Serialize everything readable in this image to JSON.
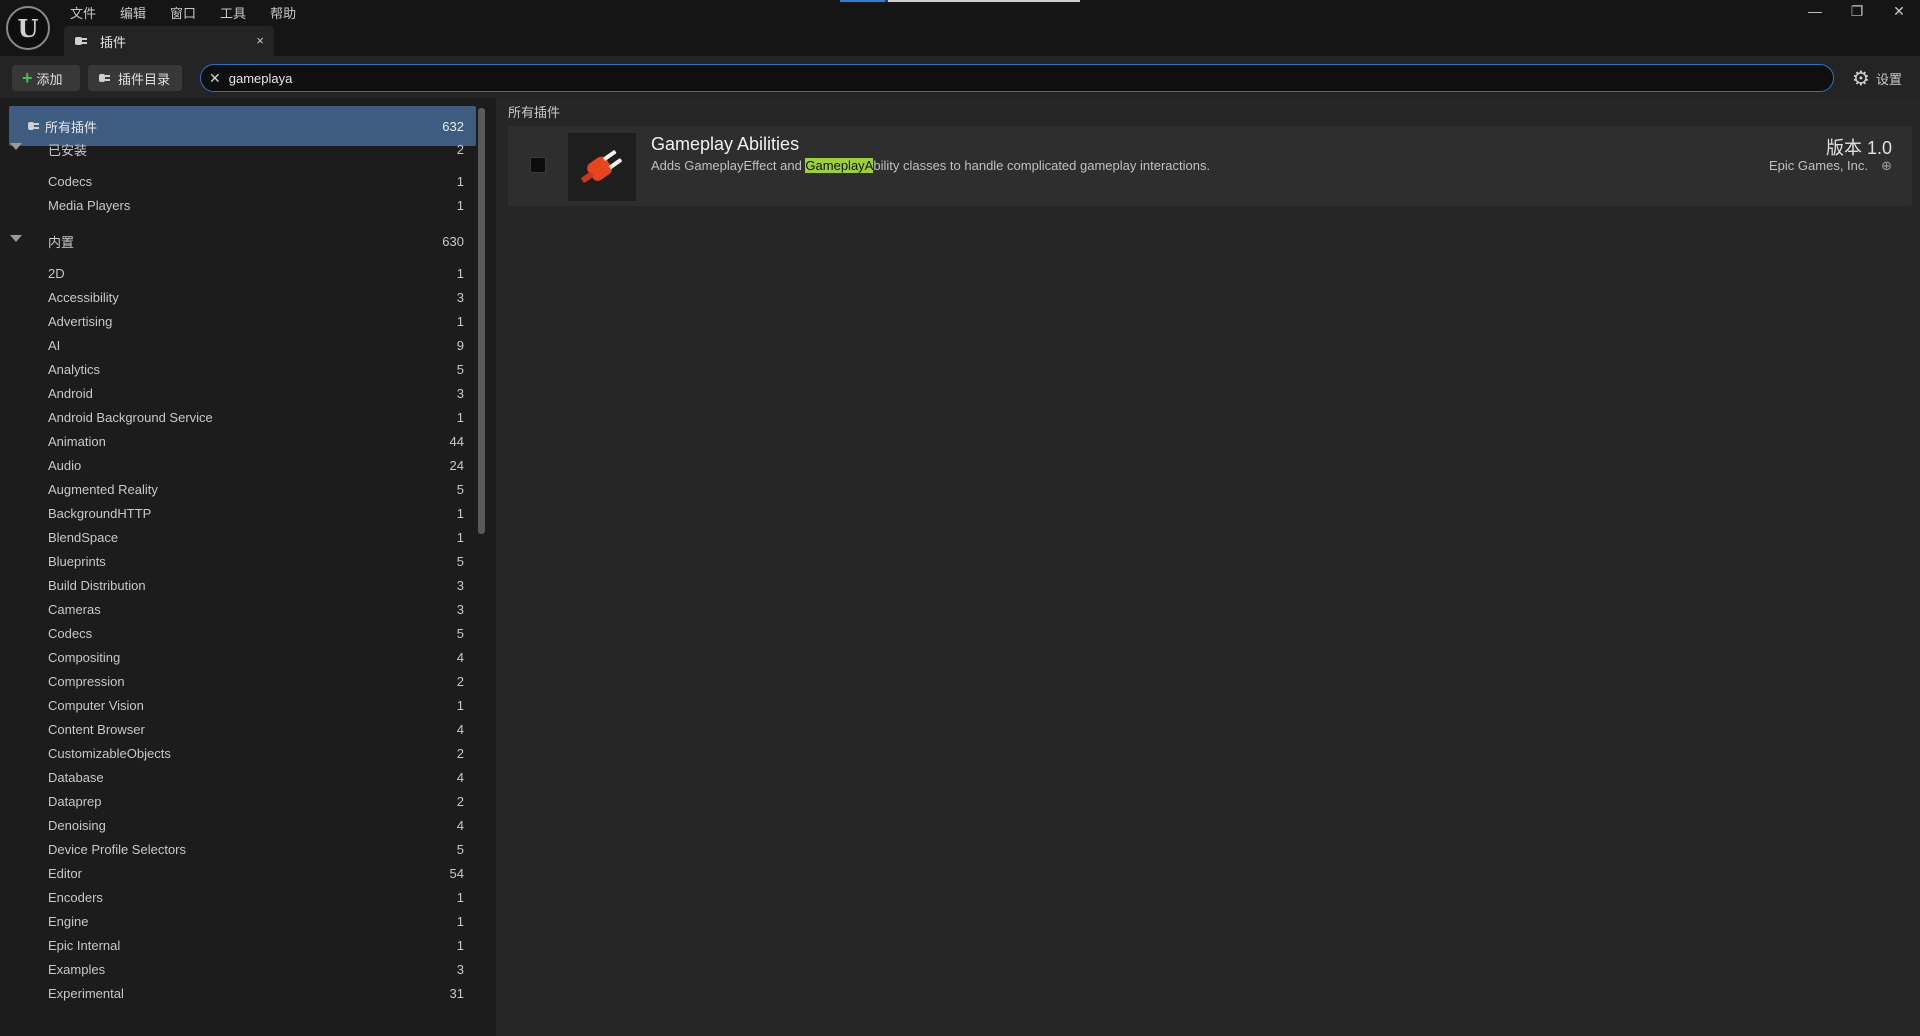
{
  "menubar": {
    "items": [
      "文件",
      "编辑",
      "窗口",
      "工具",
      "帮助"
    ]
  },
  "window_controls": {
    "minimize": "—",
    "restore": "❐",
    "close": "✕"
  },
  "tab": {
    "label": "插件",
    "close": "×"
  },
  "toolbar": {
    "add_label": "添加",
    "catalog_label": "插件目录",
    "search_value": "gameplaya",
    "settings_label": "设置"
  },
  "sidebar": {
    "all": {
      "label": "所有插件",
      "count": "632"
    },
    "installed": {
      "label": "已安装",
      "count": "2",
      "items": [
        {
          "label": "Codecs",
          "count": "1"
        },
        {
          "label": "Media Players",
          "count": "1"
        }
      ]
    },
    "builtin": {
      "label": "内置",
      "count": "630",
      "items": [
        {
          "label": "2D",
          "count": "1"
        },
        {
          "label": "Accessibility",
          "count": "3"
        },
        {
          "label": "Advertising",
          "count": "1"
        },
        {
          "label": "AI",
          "count": "9"
        },
        {
          "label": "Analytics",
          "count": "5"
        },
        {
          "label": "Android",
          "count": "3"
        },
        {
          "label": "Android Background Service",
          "count": "1"
        },
        {
          "label": "Animation",
          "count": "44"
        },
        {
          "label": "Audio",
          "count": "24"
        },
        {
          "label": "Augmented Reality",
          "count": "5"
        },
        {
          "label": "BackgroundHTTP",
          "count": "1"
        },
        {
          "label": "BlendSpace",
          "count": "1"
        },
        {
          "label": "Blueprints",
          "count": "5"
        },
        {
          "label": "Build Distribution",
          "count": "3"
        },
        {
          "label": "Cameras",
          "count": "3"
        },
        {
          "label": "Codecs",
          "count": "5"
        },
        {
          "label": "Compositing",
          "count": "4"
        },
        {
          "label": "Compression",
          "count": "2"
        },
        {
          "label": "Computer Vision",
          "count": "1"
        },
        {
          "label": "Content Browser",
          "count": "4"
        },
        {
          "label": "CustomizableObjects",
          "count": "2"
        },
        {
          "label": "Database",
          "count": "4"
        },
        {
          "label": "Dataprep",
          "count": "2"
        },
        {
          "label": "Denoising",
          "count": "4"
        },
        {
          "label": "Device Profile Selectors",
          "count": "5"
        },
        {
          "label": "Editor",
          "count": "54"
        },
        {
          "label": "Encoders",
          "count": "1"
        },
        {
          "label": "Engine",
          "count": "1"
        },
        {
          "label": "Epic Internal",
          "count": "1"
        },
        {
          "label": "Examples",
          "count": "3"
        },
        {
          "label": "Experimental",
          "count": "31"
        }
      ]
    }
  },
  "main": {
    "heading": "所有插件",
    "plugin": {
      "name": "Gameplay Abilities",
      "desc_before": "Adds GameplayEffect and ",
      "desc_highlight": "GameplayA",
      "desc_after": "bility classes to handle complicated gameplay interactions.",
      "version": "版本 1.0",
      "vendor": "Epic Games, Inc."
    }
  },
  "colors": {
    "accent": "#2b72c9",
    "selected": "#3d5c80",
    "highlight": "#9cd13c",
    "plug": "#e8451e"
  }
}
